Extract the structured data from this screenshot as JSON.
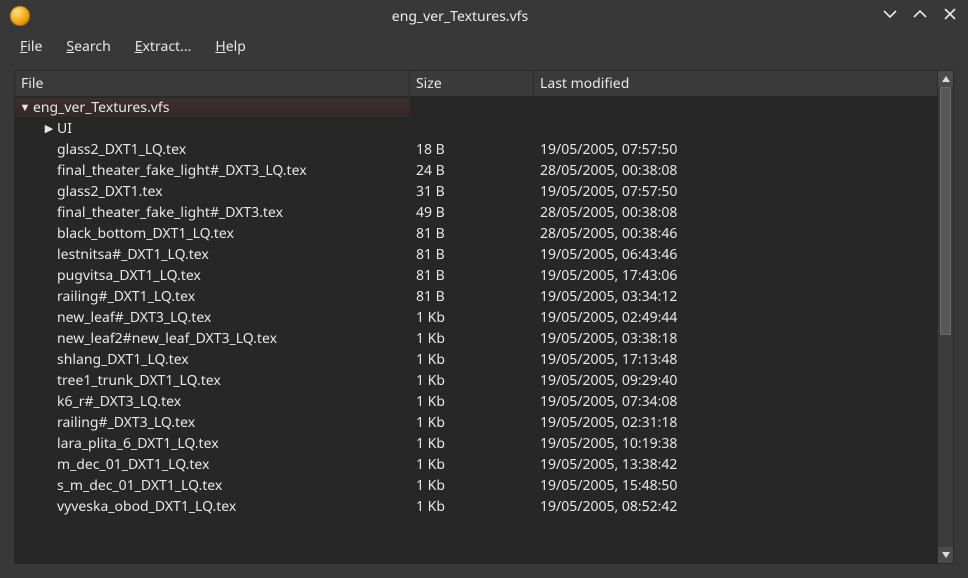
{
  "window": {
    "title": "eng_ver_Textures.vfs"
  },
  "menubar": {
    "items": [
      {
        "mnemonic": "F",
        "rest": "ile"
      },
      {
        "mnemonic": "S",
        "rest": "earch"
      },
      {
        "mnemonic": "E",
        "rest": "xtract..."
      },
      {
        "mnemonic": "H",
        "rest": "elp"
      }
    ]
  },
  "columns": {
    "file": "File",
    "size": "Size",
    "modified": "Last modified"
  },
  "tree": {
    "root": {
      "name": "eng_ver_Textures.vfs",
      "expanded": true
    },
    "folder": {
      "name": "UI",
      "expanded": false
    },
    "files": [
      {
        "name": "glass2_DXT1_LQ.tex",
        "size": "18 B",
        "modified": "19/05/2005, 07:57:50"
      },
      {
        "name": "final_theater_fake_light#_DXT3_LQ.tex",
        "size": "24 B",
        "modified": "28/05/2005, 00:38:08"
      },
      {
        "name": "glass2_DXT1.tex",
        "size": "31 B",
        "modified": "19/05/2005, 07:57:50"
      },
      {
        "name": "final_theater_fake_light#_DXT3.tex",
        "size": "49 B",
        "modified": "28/05/2005, 00:38:08"
      },
      {
        "name": "black_bottom_DXT1_LQ.tex",
        "size": "81 B",
        "modified": "28/05/2005, 00:38:46"
      },
      {
        "name": "lestnitsa#_DXT1_LQ.tex",
        "size": "81 B",
        "modified": "19/05/2005, 06:43:46"
      },
      {
        "name": "pugvitsa_DXT1_LQ.tex",
        "size": "81 B",
        "modified": "19/05/2005, 17:43:06"
      },
      {
        "name": "railing#_DXT1_LQ.tex",
        "size": "81 B",
        "modified": "19/05/2005, 03:34:12"
      },
      {
        "name": "new_leaf#_DXT3_LQ.tex",
        "size": "1 Kb",
        "modified": "19/05/2005, 02:49:44"
      },
      {
        "name": "new_leaf2#new_leaf_DXT3_LQ.tex",
        "size": "1 Kb",
        "modified": "19/05/2005, 03:38:18"
      },
      {
        "name": "shlang_DXT1_LQ.tex",
        "size": "1 Kb",
        "modified": "19/05/2005, 17:13:48"
      },
      {
        "name": "tree1_trunk_DXT1_LQ.tex",
        "size": "1 Kb",
        "modified": "19/05/2005, 09:29:40"
      },
      {
        "name": "k6_r#_DXT3_LQ.tex",
        "size": "1 Kb",
        "modified": "19/05/2005, 07:34:08"
      },
      {
        "name": "railing#_DXT3_LQ.tex",
        "size": "1 Kb",
        "modified": "19/05/2005, 02:31:18"
      },
      {
        "name": "lara_plita_6_DXT1_LQ.tex",
        "size": "1 Kb",
        "modified": "19/05/2005, 10:19:38"
      },
      {
        "name": "m_dec_01_DXT1_LQ.tex",
        "size": "1 Kb",
        "modified": "19/05/2005, 13:38:42"
      },
      {
        "name": "s_m_dec_01_DXT1_LQ.tex",
        "size": "1 Kb",
        "modified": "19/05/2005, 15:48:50"
      },
      {
        "name": "vyveska_obod_DXT1_LQ.tex",
        "size": "1 Kb",
        "modified": "19/05/2005, 08:52:42"
      }
    ]
  }
}
